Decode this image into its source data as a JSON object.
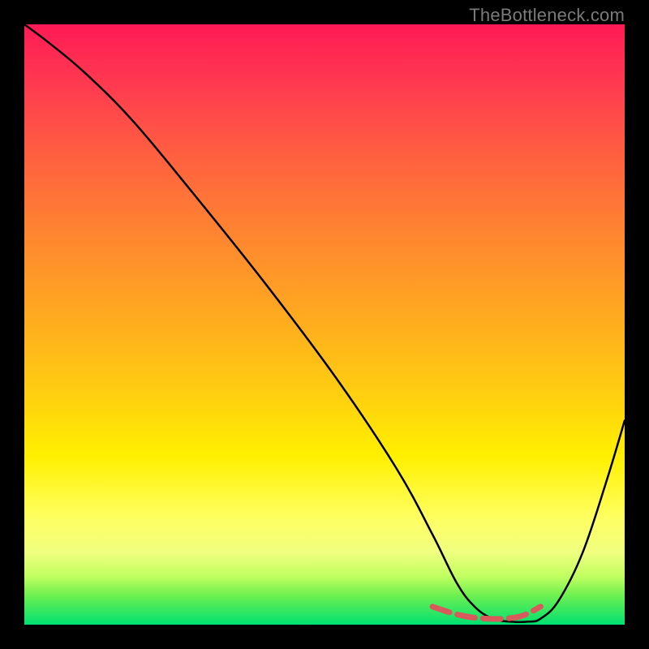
{
  "watermark": "TheBottleneck.com",
  "chart_data": {
    "type": "line",
    "title": "",
    "xlabel": "",
    "ylabel": "",
    "xlim": [
      0,
      100
    ],
    "ylim": [
      0,
      100
    ],
    "series": [
      {
        "name": "curve",
        "x": [
          0,
          4,
          10,
          18,
          28,
          40,
          52,
          62,
          68,
          72,
          75,
          78,
          81,
          84,
          86,
          89,
          93,
          97,
          100
        ],
        "values": [
          100,
          97,
          92,
          84,
          72,
          57,
          41,
          26,
          15,
          7,
          3,
          1,
          0.5,
          0.5,
          1,
          4,
          12,
          24,
          34
        ]
      }
    ],
    "highlight": {
      "name": "dashed-region",
      "x": [
        68,
        71,
        74,
        77,
        80,
        83,
        86
      ],
      "values": [
        3.0,
        2.0,
        1.3,
        1.0,
        1.0,
        1.5,
        3.0
      ]
    },
    "colors": {
      "curve": "#000000",
      "highlight": "#d85a5a",
      "gradient_top": "#ff1a55",
      "gradient_bottom": "#00e070"
    }
  }
}
